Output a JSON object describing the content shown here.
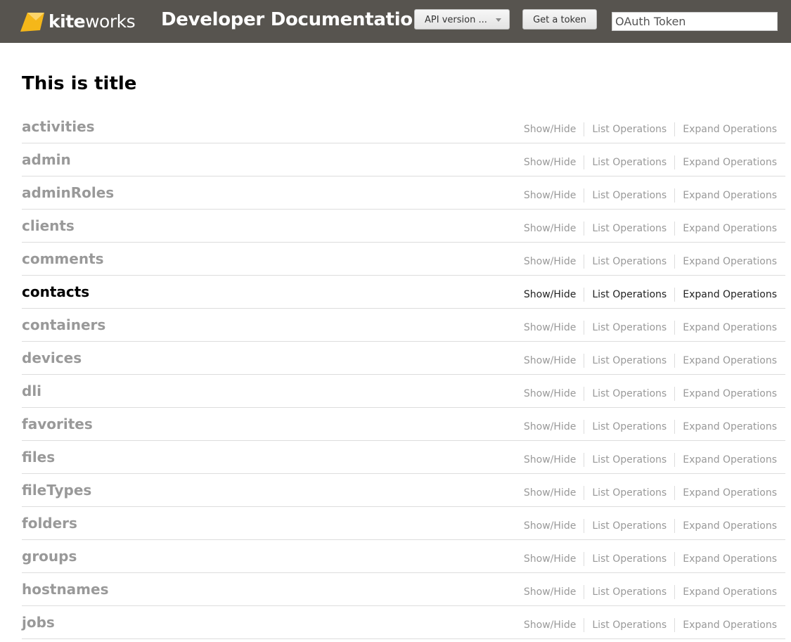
{
  "header": {
    "logo_kite": "kite",
    "logo_works": "works",
    "title": "Developer Documentation",
    "api_version_label": "API version ...",
    "get_token_label": "Get a token",
    "token_placeholder": "OAuth Token"
  },
  "page": {
    "title": "This is title"
  },
  "row_link_labels": {
    "show_hide": "Show/Hide",
    "list_operations": "List Operations",
    "expand_operations": "Expand Operations"
  },
  "resources": [
    {
      "name": "activities",
      "active": false
    },
    {
      "name": "admin",
      "active": false
    },
    {
      "name": "adminRoles",
      "active": false
    },
    {
      "name": "clients",
      "active": false
    },
    {
      "name": "comments",
      "active": false
    },
    {
      "name": "contacts",
      "active": true
    },
    {
      "name": "containers",
      "active": false
    },
    {
      "name": "devices",
      "active": false
    },
    {
      "name": "dli",
      "active": false
    },
    {
      "name": "favorites",
      "active": false
    },
    {
      "name": "files",
      "active": false
    },
    {
      "name": "fileTypes",
      "active": false
    },
    {
      "name": "folders",
      "active": false
    },
    {
      "name": "groups",
      "active": false
    },
    {
      "name": "hostnames",
      "active": false
    },
    {
      "name": "jobs",
      "active": false
    }
  ],
  "colors": {
    "header_bg": "#57544f",
    "logo_yellow": "#f5b719",
    "inactive_text": "#999999",
    "active_text": "#000000"
  }
}
